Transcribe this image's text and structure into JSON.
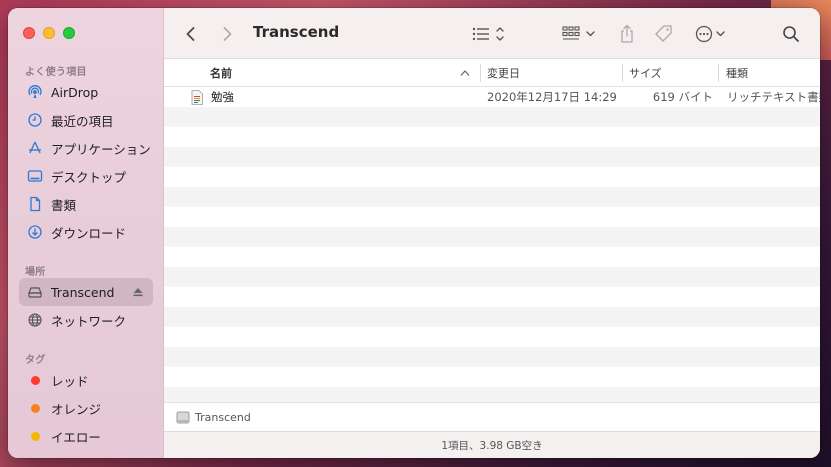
{
  "window": {
    "title": "Transcend"
  },
  "sidebar": {
    "favorites_label": "よく使う項目",
    "favorites": [
      {
        "label": "AirDrop",
        "icon": "airdrop-icon"
      },
      {
        "label": "最近の項目",
        "icon": "clock-icon"
      },
      {
        "label": "アプリケーション",
        "icon": "applications-icon"
      },
      {
        "label": "デスクトップ",
        "icon": "desktop-icon"
      },
      {
        "label": "書類",
        "icon": "document-icon"
      },
      {
        "label": "ダウンロード",
        "icon": "download-icon"
      }
    ],
    "locations_label": "場所",
    "locations": [
      {
        "label": "Transcend",
        "icon": "drive-icon",
        "selected": true
      },
      {
        "label": "ネットワーク",
        "icon": "network-icon"
      }
    ],
    "tags_label": "タグ",
    "tags": [
      {
        "label": "レッド",
        "color": "#ff3b30"
      },
      {
        "label": "オレンジ",
        "color": "#ff9500"
      },
      {
        "label": "イエロー",
        "color": "#ffcc00"
      }
    ]
  },
  "columns": {
    "name": "名前",
    "modified": "変更日",
    "size": "サイズ",
    "kind": "種類"
  },
  "files": [
    {
      "name": "勉強",
      "modified": "2020年12月17日 14:29",
      "size": "619 バイト",
      "kind": "リッチテキスト書類",
      "icon": "rtf-document-icon"
    }
  ],
  "pathbar": {
    "label": "Transcend",
    "icon": "drive-icon"
  },
  "status": {
    "text": "1項目、3.98 GB空き"
  },
  "colors": {
    "accent": "#2a7ad6",
    "sidebar_bg": "#ecd0dc"
  }
}
